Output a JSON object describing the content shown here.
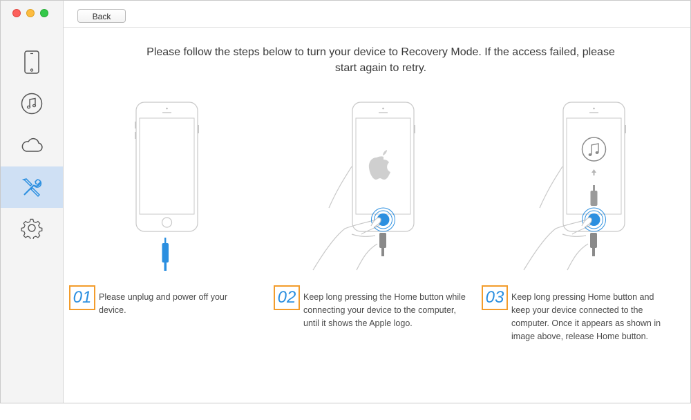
{
  "window": {
    "controls": [
      "close",
      "minimize",
      "zoom"
    ]
  },
  "sidebar": {
    "items": [
      {
        "icon": "phone-icon",
        "active": false
      },
      {
        "icon": "music-icon",
        "active": false
      },
      {
        "icon": "cloud-icon",
        "active": false
      },
      {
        "icon": "tools-icon",
        "active": true
      },
      {
        "icon": "settings-icon",
        "active": false
      }
    ],
    "active_color": "#cfe0f4"
  },
  "toolbar": {
    "back_label": "Back"
  },
  "main": {
    "instruction": "Please follow the steps below to turn your device to Recovery Mode. If the access failed, please start again to retry.",
    "steps": [
      {
        "number": "01",
        "text": "Please unplug and power off your device."
      },
      {
        "number": "02",
        "text": "Keep long pressing the Home button while connecting your device to the computer, until it shows the Apple logo."
      },
      {
        "number": "03",
        "text": "Keep long pressing Home button and keep your device connected to the computer. Once it appears as shown in image above, release Home button."
      }
    ]
  },
  "colors": {
    "accent_blue": "#2b8fe0",
    "step_border": "#f39c2b",
    "sidebar_bg": "#f4f4f4"
  }
}
